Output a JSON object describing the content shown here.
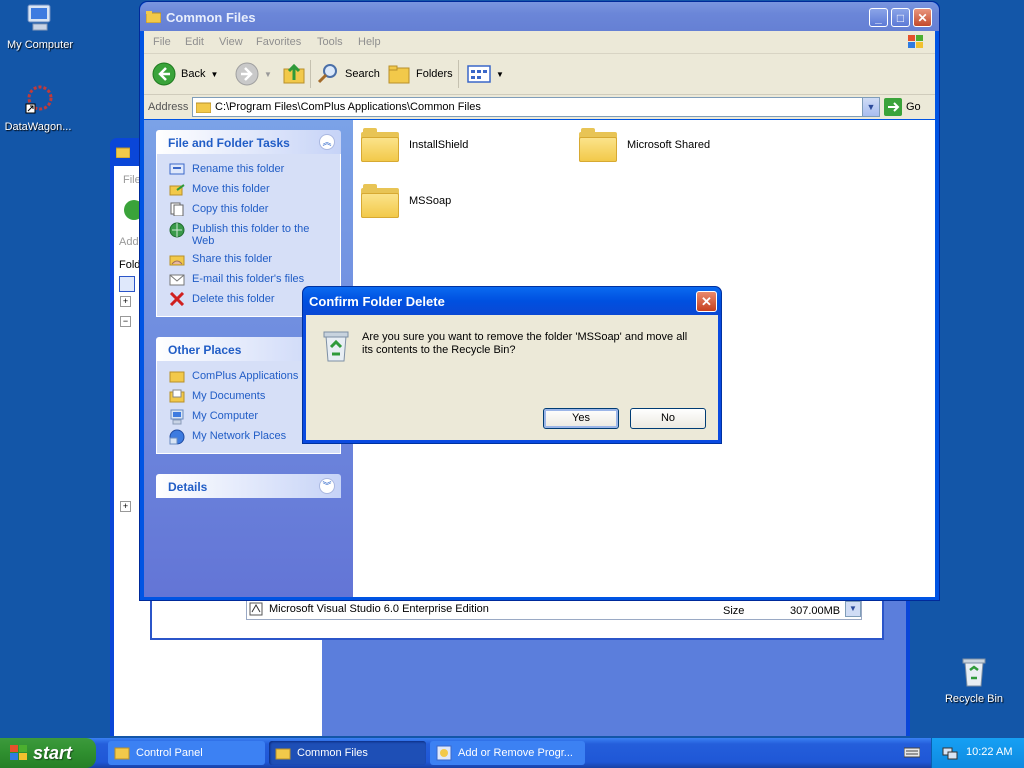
{
  "desktop": {
    "icons": [
      {
        "label": "My Computer"
      },
      {
        "label": "DataWagon..."
      },
      {
        "label": "Recycle Bin"
      }
    ]
  },
  "background_window": {
    "menu_fragment": "File",
    "address_fragment": "Add",
    "folders_fragment": "Fold",
    "program_name": "Microsoft Visual Studio 6.0 Enterprise Edition",
    "size_label": "Size",
    "size_value": "307.00MB"
  },
  "window": {
    "title": "Common Files",
    "menu": [
      "File",
      "Edit",
      "View",
      "Favorites",
      "Tools",
      "Help"
    ],
    "toolbar": {
      "back": "Back",
      "search": "Search",
      "folders": "Folders"
    },
    "address": {
      "label": "Address",
      "path": "C:\\Program Files\\ComPlus Applications\\Common Files",
      "go": "Go"
    },
    "file_tasks": {
      "title": "File and Folder Tasks",
      "items": [
        {
          "label": "Rename this folder"
        },
        {
          "label": "Move this folder"
        },
        {
          "label": "Copy this folder"
        },
        {
          "label": "Publish this folder to the Web"
        },
        {
          "label": "Share this folder"
        },
        {
          "label": "E-mail this folder's files"
        },
        {
          "label": "Delete this folder"
        }
      ]
    },
    "other_places": {
      "title": "Other Places",
      "items": [
        {
          "label": "ComPlus Applications"
        },
        {
          "label": "My Documents"
        },
        {
          "label": "My Computer"
        },
        {
          "label": "My Network Places"
        }
      ]
    },
    "details": {
      "title": "Details"
    },
    "folders": [
      {
        "name": "InstallShield"
      },
      {
        "name": "Microsoft Shared"
      },
      {
        "name": "MSSoap"
      }
    ]
  },
  "dialog": {
    "title": "Confirm Folder Delete",
    "message": "Are you sure you want to remove the folder 'MSSoap' and move all its contents to the Recycle Bin?",
    "yes": "Yes",
    "no": "No"
  },
  "taskbar": {
    "start": "start",
    "tasks": [
      {
        "label": "Control Panel"
      },
      {
        "label": "Common Files"
      },
      {
        "label": "Add or Remove Progr..."
      }
    ],
    "clock": "10:22 AM"
  }
}
